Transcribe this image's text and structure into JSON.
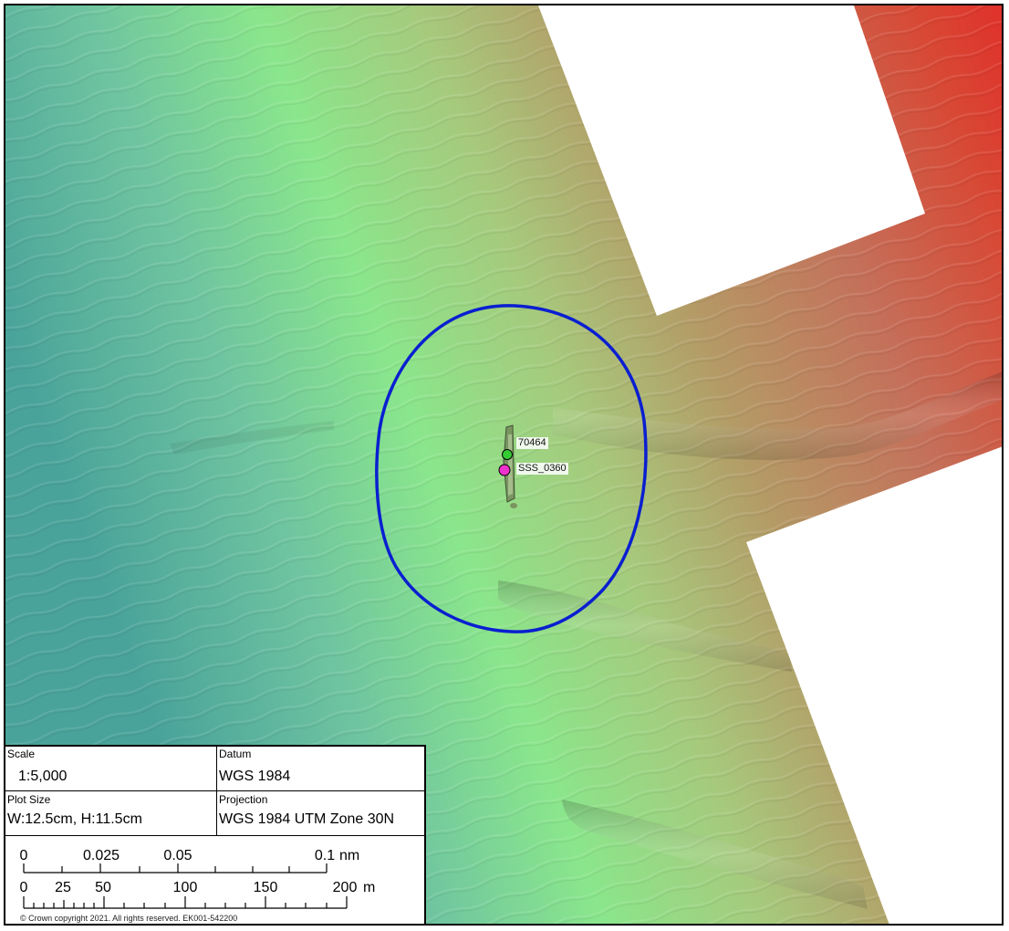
{
  "map": {
    "features": [
      {
        "label": "70464",
        "color": "#33cc33"
      },
      {
        "label": "SSS_0360",
        "color": "#ee33cc"
      }
    ],
    "buffer_color": "#0a1fd0",
    "nodata_color": "#ffffff"
  },
  "info": {
    "scale_label": "Scale",
    "scale_value": "1:5,000",
    "datum_label": "Datum",
    "datum_value": "WGS 1984",
    "plot_size_label": "Plot Size",
    "plot_size_value": "W:12.5cm, H:11.5cm",
    "projection_label": "Projection",
    "projection_value": "WGS 1984 UTM Zone 30N",
    "scalebar_nm": {
      "ticks": [
        "0",
        "0.025",
        "0.05",
        "0.1"
      ],
      "unit": "nm"
    },
    "scalebar_m": {
      "ticks": [
        "0",
        "25",
        "50",
        "100",
        "150",
        "200"
      ],
      "unit": "m"
    },
    "copyright": "© Crown copyright 2021. All rights reserved. EK001-542200"
  }
}
